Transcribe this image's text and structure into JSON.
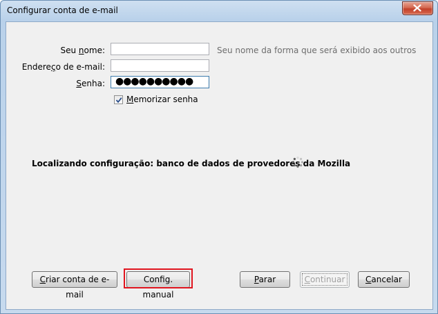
{
  "window": {
    "title": "Configurar conta de e-mail"
  },
  "icons": {
    "close": "close-icon",
    "spinner": "loading-spinner-icon",
    "check": "checkmark-icon"
  },
  "form": {
    "name_label_pre": "Seu ",
    "name_label_key": "n",
    "name_label_post": "ome:",
    "name_value": "",
    "name_hint": "Seu nome da forma que será exibido aos outros",
    "email_label_pre": "Endere",
    "email_label_key": "ç",
    "email_label_post": "o de e-mail:",
    "email_value": "",
    "password_label_key": "S",
    "password_label_post": "enha:",
    "password_value": "●●●●●●●●●●",
    "remember_checked": true,
    "remember_label_key": "M",
    "remember_label_post": "emorizar senha"
  },
  "status": {
    "text": "Localizando configuração: banco de dados de provedores da Mozilla"
  },
  "buttons": {
    "create_key": "C",
    "create_post": "riar conta de e-mail",
    "manual": "Config. manual",
    "manual_key": "g",
    "stop_key": "P",
    "stop_post": "arar",
    "continue_key": "C",
    "continue_post": "ontinuar",
    "cancel_key": "C",
    "cancel_post": "ancelar"
  },
  "colors": {
    "highlight": "#e0141e",
    "hint_text": "#6d6d6d",
    "title_bar": "#b9d1ea",
    "close_button": "#c2412a"
  }
}
